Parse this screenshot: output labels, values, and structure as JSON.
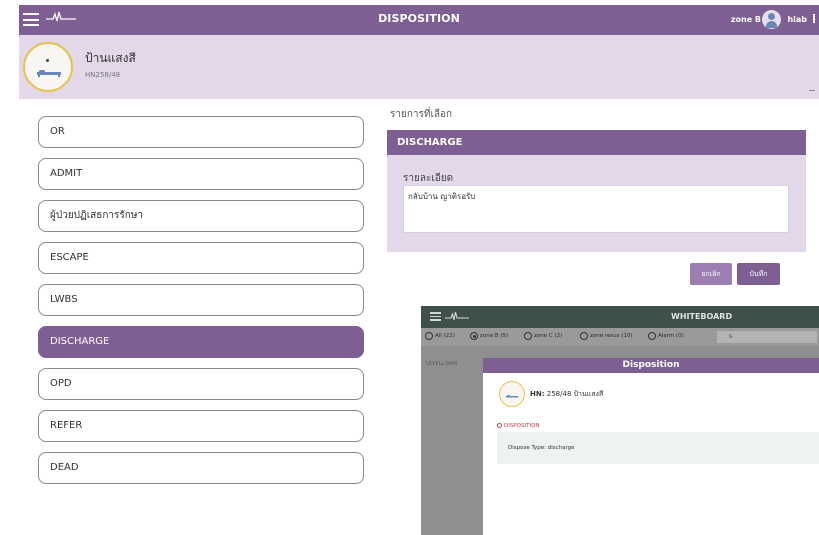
{
  "header": {
    "title": "DISPOSITION",
    "zone": "zone B",
    "user": "hlab",
    "icons": [
      "menu-icon",
      "pulse-logo-icon",
      "user-avatar-icon",
      "kebab-menu-icon"
    ]
  },
  "patient": {
    "name": "ป้านแสงสี",
    "hn": "HN258/48"
  },
  "options": [
    "OR",
    "ADMIT",
    "ผู้ป่วยปฏิเสธการรักษา",
    "ESCAPE",
    "LWBS",
    "DISCHARGE",
    "OPD",
    "REFER",
    "DEAD"
  ],
  "selected_option": "DISCHARGE",
  "selection": {
    "label": "รายการที่เลือก",
    "header": "DISCHARGE",
    "detail_label": "รายละเอียด",
    "detail_value": "กลับบ้าน ญาติรอรับ"
  },
  "buttons": {
    "cancel": "ยกเลิก",
    "save": "บันทึก"
  },
  "colors": {
    "primary": "#7d5f93",
    "light": "#e2d8e9",
    "gold": "#e7c34a",
    "alert": "#c43c3c"
  },
  "inset": {
    "title": "WHITEBOARD",
    "filters": [
      "All (22)",
      "zone B (5)",
      "zone C (2)",
      "zone resus (10)",
      "Alarm (0)"
    ],
    "selected_filter": "zone B (5)",
    "search_value": "s",
    "column_hint": "LEVEL▴ NAM",
    "modal": {
      "title": "Disposition",
      "hn_label": "HN:",
      "hn_value": "258/48 ป้านแสงสี",
      "section": "DISPOSITION",
      "dispose_type": "Dispose Type: discharge"
    }
  }
}
